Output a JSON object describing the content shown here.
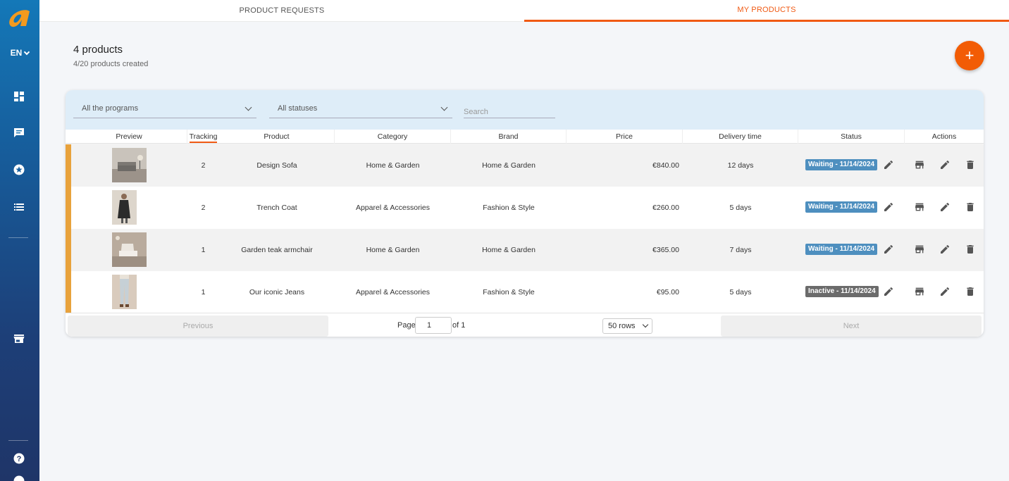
{
  "sidebar": {
    "language": "EN",
    "icons": [
      "dashboard-icon",
      "chat-icon",
      "star-icon",
      "list-icon",
      "store-icon",
      "help-icon"
    ]
  },
  "tabs": [
    {
      "label": "PRODUCT REQUESTS",
      "active": false
    },
    {
      "label": "MY PRODUCTS",
      "active": true
    }
  ],
  "header": {
    "title": "4 products",
    "subtitle": "4/20 products created",
    "add_label": "+"
  },
  "filters": {
    "program": "All the programs",
    "status": "All statuses",
    "search_placeholder": "Search"
  },
  "columns": [
    "Preview",
    "Tracking",
    "Product",
    "Category",
    "Brand",
    "Price",
    "Delivery time",
    "Status",
    "Actions"
  ],
  "rows": [
    {
      "tracking": "2",
      "product": "Design Sofa",
      "category": "Home & Garden",
      "brand": "Home & Garden",
      "price": "€840.00",
      "delivery": "12 days",
      "status": "Waiting - 11/14/2024",
      "status_type": "waiting",
      "thumb": "sofa"
    },
    {
      "tracking": "2",
      "product": "Trench Coat",
      "category": "Apparel & Accessories",
      "brand": "Fashion & Style",
      "price": "€260.00",
      "delivery": "5 days",
      "status": "Waiting - 11/14/2024",
      "status_type": "waiting",
      "thumb": "coat"
    },
    {
      "tracking": "1",
      "product": "Garden teak armchair",
      "category": "Home & Garden",
      "brand": "Home & Garden",
      "price": "€365.00",
      "delivery": "7 days",
      "status": "Waiting - 11/14/2024",
      "status_type": "waiting",
      "thumb": "armchair"
    },
    {
      "tracking": "1",
      "product": "Our iconic Jeans",
      "category": "Apparel & Accessories",
      "brand": "Fashion & Style",
      "price": "€95.00",
      "delivery": "5 days",
      "status": "Inactive - 11/14/2024",
      "status_type": "inactive",
      "thumb": "jeans"
    }
  ],
  "pagination": {
    "previous": "Previous",
    "page_label": "Page",
    "page": "1",
    "of_label": "of 1",
    "rows_per_page": "50 rows",
    "next": "Next"
  },
  "colors": {
    "accent": "#f05a14",
    "row_marker": "#e8a23c",
    "waiting": "#4e8fbf",
    "inactive": "#6b6b6b"
  }
}
